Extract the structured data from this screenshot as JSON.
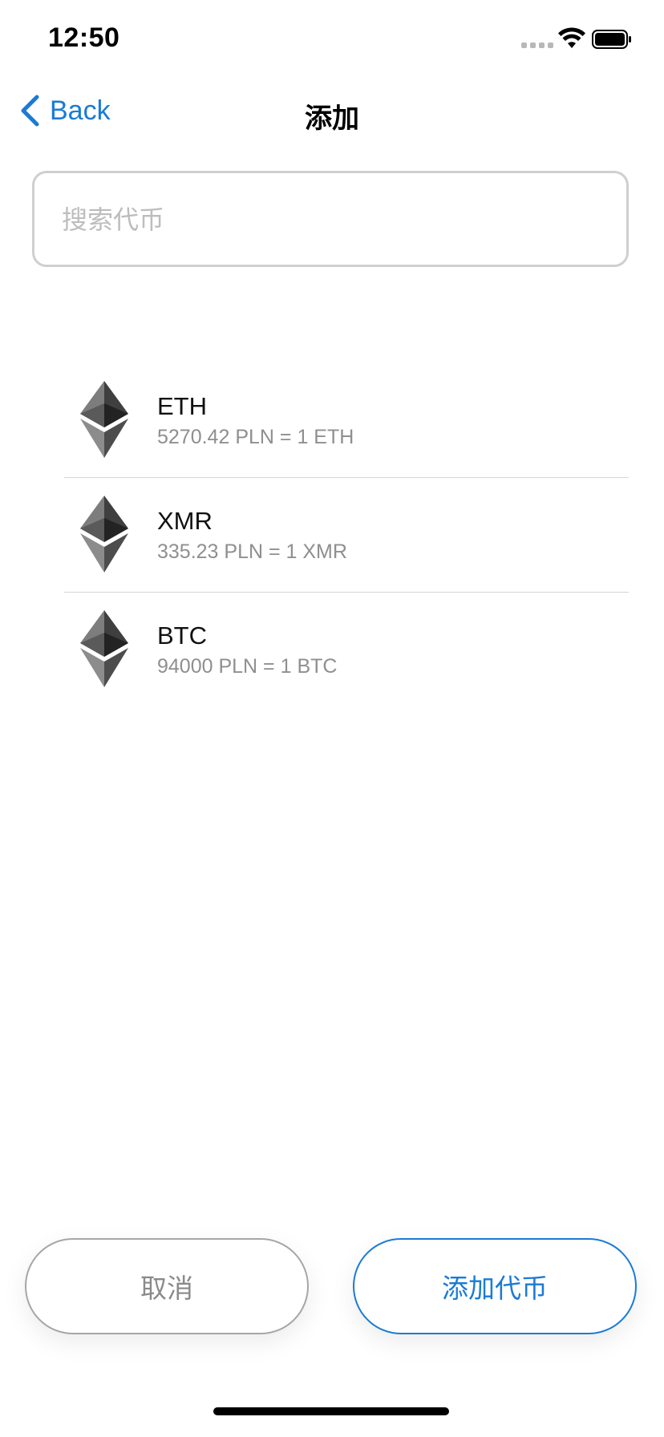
{
  "status_bar": {
    "time": "12:50"
  },
  "nav": {
    "back_label": "Back",
    "title": "添加"
  },
  "search": {
    "value": "",
    "placeholder": "搜索代币"
  },
  "coins": [
    {
      "symbol": "ETH",
      "rate": "5270.42 PLN = 1 ETH",
      "icon": "ethereum-icon"
    },
    {
      "symbol": "XMR",
      "rate": "335.23 PLN = 1 XMR",
      "icon": "ethereum-icon"
    },
    {
      "symbol": "BTC",
      "rate": "94000 PLN = 1 BTC",
      "icon": "ethereum-icon"
    }
  ],
  "actions": {
    "cancel_label": "取消",
    "add_label": "添加代币"
  },
  "colors": {
    "accent": "#1a7bd6",
    "muted_text": "#8f8f8f",
    "border": "#cfcfcf"
  }
}
